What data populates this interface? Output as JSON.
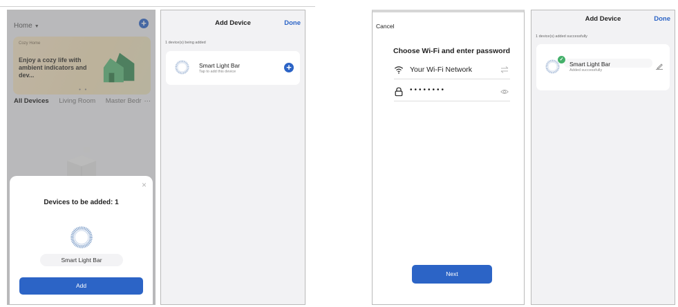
{
  "screen1": {
    "home_title": "Home",
    "banner_tag": "Cozy Home",
    "banner_text": "Enjoy a cozy life with ambient indicators and dev...",
    "rooms": [
      "All Devices",
      "Living Room",
      "Master Bedr"
    ],
    "rooms_more": "···",
    "sheet_close": "×",
    "sheet_title": "Devices to be added: 1",
    "device_name": "Smart Light Bar",
    "add_label": "Add"
  },
  "screen2": {
    "nav_title": "Add Device",
    "done_label": "Done",
    "status": "1 device(s) being added",
    "device_name": "Smart Light Bar",
    "device_sub": "Tap to add this device"
  },
  "screen3": {
    "cancel_label": "Cancel",
    "title": "Choose Wi-Fi and enter password",
    "network_value": "Your Wi-Fi Network",
    "password_value": "••••••••",
    "next_label": "Next"
  },
  "screen4": {
    "nav_title": "Add Device",
    "done_label": "Done",
    "status": "1 device(s) added successfully",
    "device_name": "Smart Light Bar",
    "device_sub": "Added successfully"
  },
  "icons": {
    "plus": "plus-icon",
    "caret": "caret-down-icon",
    "close": "close-icon",
    "ring": "device-ring-icon",
    "check": "check-icon",
    "edit": "pencil-icon",
    "wifi": "wifi-icon",
    "lock": "lock-icon",
    "swap": "swap-icon",
    "eye": "eye-icon"
  },
  "colors": {
    "accent": "#2c64c6",
    "success": "#44b06a",
    "banner": "#f1dfb9"
  }
}
